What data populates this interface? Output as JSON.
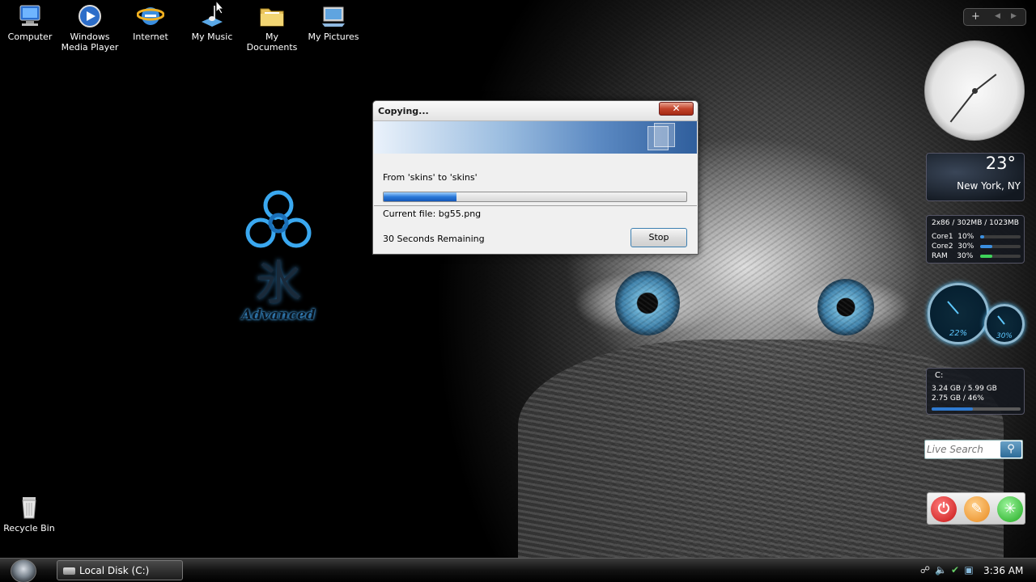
{
  "desktop": {
    "icons": [
      {
        "label": "Computer"
      },
      {
        "label": "Windows Media Player"
      },
      {
        "label": "Internet"
      },
      {
        "label": "My Music"
      },
      {
        "label": "My Documents"
      },
      {
        "label": "My Pictures"
      }
    ],
    "recycle_bin": {
      "label": "Recycle Bin"
    },
    "logo": {
      "kanji": "氷",
      "text": "Advanced"
    }
  },
  "copy_dialog": {
    "title": "Copying...",
    "close_label": "✕",
    "from_text": "From 'skins' to 'skins'",
    "progress_fraction": 0.24,
    "current_file_text": "Current file:  bg55.png",
    "remaining_text": "30 Seconds Remaining",
    "stop_label": "Stop"
  },
  "sidebar": {
    "controls": {
      "add": "+",
      "prev": "◀",
      "next": "▶"
    },
    "weather": {
      "temp": "23°",
      "city": "New York, NY"
    },
    "cpu": {
      "summary": "2x86 / 302MB / 1023MB",
      "rows": [
        {
          "label": "Core1",
          "value": "10%",
          "fraction": 0.1,
          "color": "#3b8fe0"
        },
        {
          "label": "Core2",
          "value": "30%",
          "fraction": 0.3,
          "color": "#3b8fe0"
        },
        {
          "label": "RAM",
          "value": "30%",
          "fraction": 0.3,
          "color": "#3ed35a"
        }
      ]
    },
    "gauges": {
      "cpu_value": "22%",
      "mem_value": "30%"
    },
    "drive": {
      "name": "C:",
      "line1": "3.24 GB / 5.99 GB",
      "line2": "2.75 GB / 46%",
      "fraction": 0.46
    },
    "search": {
      "placeholder": "Live Search"
    }
  },
  "taskbar": {
    "task_label": "Local Disk (C:)",
    "time": "3:36 AM"
  },
  "colors": {
    "progress_fill": "#2a78d8",
    "close_button": "#c3442c",
    "power_red": "#d42020",
    "power_orange": "#f0a030",
    "power_green": "#30c030"
  }
}
